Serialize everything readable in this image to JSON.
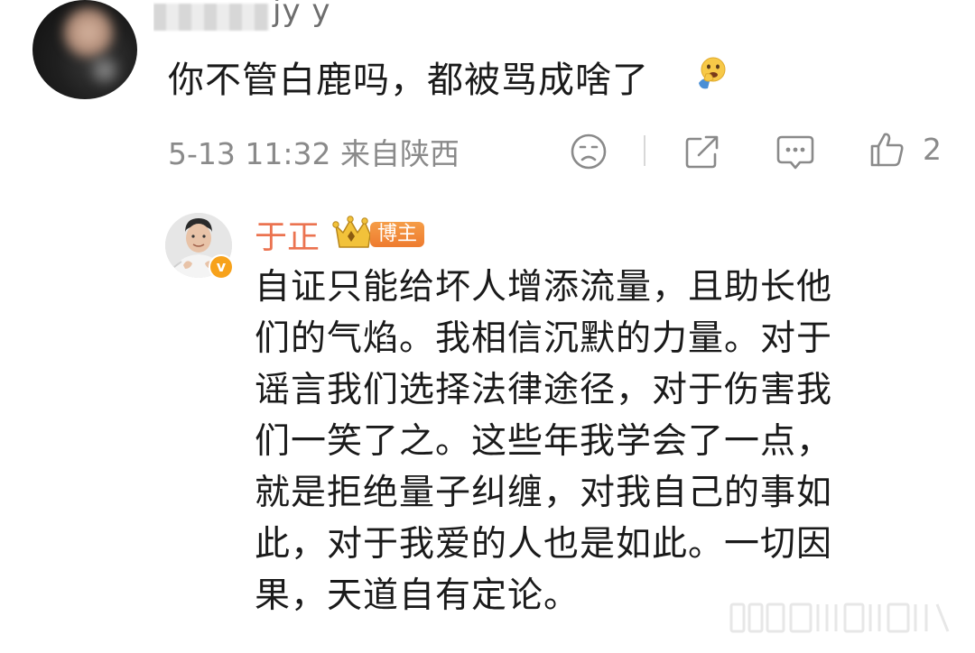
{
  "comment": {
    "username_visible": "jy y",
    "text": "你不管白鹿吗，都被骂成啥了",
    "emoji_icon": "facepalm-face-emoji",
    "meta": "5-13 11:32 来自陕西",
    "actions": {
      "dislike_icon": "sad-face-icon",
      "share_icon": "share-icon",
      "reply_icon": "comment-bubble-icon",
      "like_icon": "thumbs-up-icon",
      "like_count": "2"
    }
  },
  "reply": {
    "author": "于正",
    "badge_label": "博主",
    "verified_mark": "v",
    "lines": [
      "自证只能给坏人增添流量，且助长他",
      "们的气焰。我相信沉默的力量。对于",
      "谣言我们选择法律途径，对于伤害我",
      "们一笑了之。这些年我学会了一点，",
      "就是拒绝量子纠缠，对我自己的事如",
      "此，对于我爱的人也是如此。一切因",
      "果，天道自有定论。"
    ]
  },
  "colors": {
    "author_orange": "#eb7350",
    "badge_orange": "#ee7b2f",
    "meta_gray": "#8a8a8a",
    "verified_gold": "#f7a21b"
  }
}
